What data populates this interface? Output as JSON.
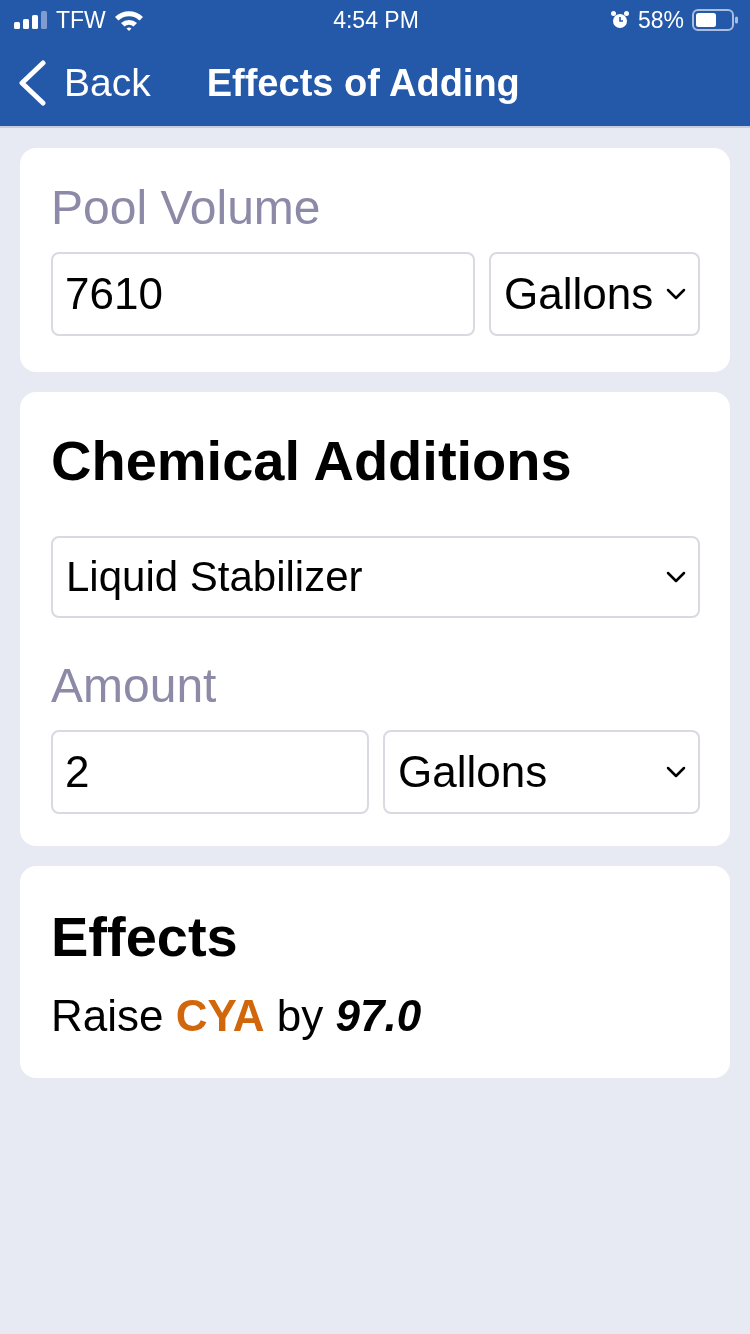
{
  "status_bar": {
    "carrier": "TFW",
    "time": "4:54 PM",
    "battery": "58%"
  },
  "nav": {
    "back": "Back",
    "title": "Effects of Adding"
  },
  "pool_volume": {
    "label": "Pool Volume",
    "value": "7610",
    "unit": "Gallons"
  },
  "chemical_additions": {
    "title": "Chemical Additions",
    "chemical": "Liquid Stabilizer",
    "amount_label": "Amount",
    "amount": "2",
    "unit": "Gallons"
  },
  "effects": {
    "title": "Effects",
    "lines": [
      "Raise **CYA** by *97.0*"
    ]
  }
}
